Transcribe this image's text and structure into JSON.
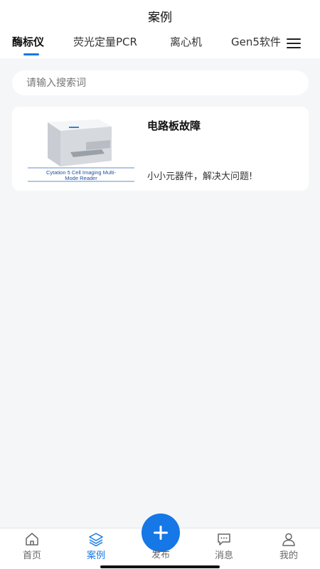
{
  "header": {
    "title": "案例"
  },
  "tabs": [
    {
      "label": "酶标仪",
      "active": true
    },
    {
      "label": "荧光定量PCR",
      "active": false
    },
    {
      "label": "离心机",
      "active": false
    },
    {
      "label": "Gen5软件",
      "active": false
    }
  ],
  "search": {
    "placeholder": "请输入搜索词"
  },
  "cases": [
    {
      "title": "电路板故障",
      "description": "小小元器件，解决大问题!",
      "image_caption_line1": "Cytation 5 Cell Imaging Multi-",
      "image_caption_line2": "Mode Reader"
    }
  ],
  "bottom_nav": {
    "home": "首页",
    "cases": "案例",
    "publish": "发布",
    "messages": "消息",
    "mine": "我的"
  },
  "colors": {
    "accent": "#1677e6",
    "background": "#f5f6f7"
  }
}
